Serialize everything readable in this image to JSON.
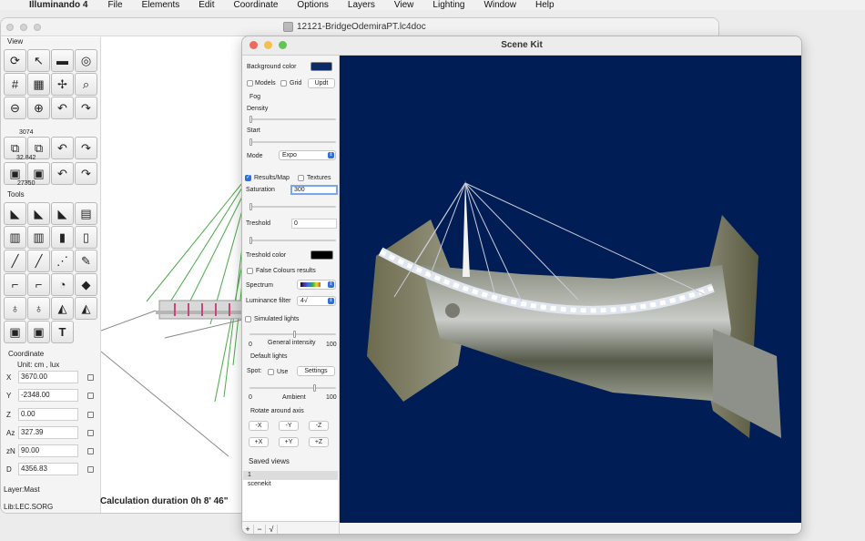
{
  "menubar": {
    "app_name": "Illuminando 4",
    "items": [
      "File",
      "Elements",
      "Edit",
      "Coordinate",
      "Options",
      "Layers",
      "View",
      "Lighting",
      "Window",
      "Help"
    ]
  },
  "main_window": {
    "title": "12121-BridgeOdemiraPT.lc4doc",
    "view_label": "View",
    "tools_label": "Tools",
    "view_values": [
      "3074",
      "32.842",
      "27350"
    ],
    "coordinate": {
      "heading": "Coordinate",
      "unit": "Unit:  cm ,  lux",
      "rows": [
        {
          "label": "X",
          "value": "3670.00"
        },
        {
          "label": "Y",
          "value": "-2348.00"
        },
        {
          "label": "Z",
          "value": "0.00"
        },
        {
          "label": "Az",
          "value": "327.39"
        },
        {
          "label": "zN",
          "value": "90.00"
        },
        {
          "label": "D",
          "value": "4356.83"
        }
      ]
    },
    "layer": "Layer:Mast",
    "lib": "Lib:LEC.SORG",
    "status": "Calculation duration 0h 8' 46\"",
    "text_tool": "T"
  },
  "scene_kit": {
    "title": "Scene Kit",
    "background_color_label": "Background color",
    "background_color": "#0c2a66",
    "models_label": "Models",
    "grid_label": "Grid",
    "updt_label": "Updt",
    "fog_label": "Fog",
    "density_label": "Density",
    "start_label": "Start",
    "mode_label": "Mode",
    "mode_value": "Expo",
    "results_map_label": "Results/Map",
    "textures_label": "Textures",
    "saturation_label": "Saturation",
    "saturation_value": "300",
    "treshold_label": "Treshold",
    "treshold_value": "0",
    "treshold_color_label": "Treshold color",
    "treshold_color": "#000000",
    "false_colours_label": "False Colours results",
    "spectrum_label": "Spectrum",
    "luminance_filter_label": "Luminance filter",
    "luminance_filter_value": "4√",
    "simulated_lights_label": "Simulated lights",
    "general_intensity_label": "General intensity",
    "slider_min": "0",
    "slider_max": "100",
    "default_lights_label": "Default lights",
    "spot_label": "Spot:",
    "use_label": "Use",
    "settings_label": "Settings",
    "ambient_label": "Ambient",
    "rotate_label": "Rotate around axis",
    "axis_buttons": [
      "-X",
      "-Y",
      "-Z",
      "+X",
      "+Y",
      "+Z"
    ],
    "saved_views_label": "Saved views",
    "saved_views": [
      "1",
      "scenekit"
    ],
    "bottom_buttons": [
      "+",
      "−",
      "√"
    ]
  },
  "colors": {
    "scene_background": "#001d55",
    "accent": "#2f6fd9"
  }
}
